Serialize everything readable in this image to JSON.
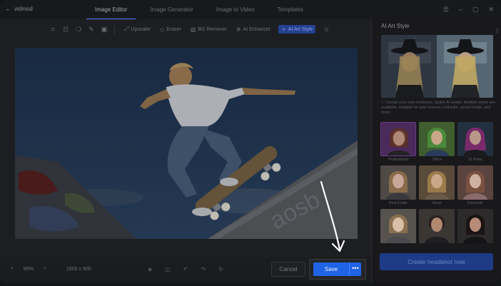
{
  "app": {
    "back_label": "vidmod"
  },
  "tabs": [
    {
      "label": "Image Editor",
      "active": true
    },
    {
      "label": "Image Generator",
      "active": false
    },
    {
      "label": "Image to Video",
      "active": false
    },
    {
      "label": "Templates",
      "active": false
    }
  ],
  "toolbar": {
    "features": [
      {
        "label": "Upscaler",
        "icon": "upscale-icon"
      },
      {
        "label": "Eraser",
        "icon": "eraser-icon"
      },
      {
        "label": "BG Remover",
        "icon": "bg-remove-icon"
      },
      {
        "label": "AI Enhancer",
        "icon": "sparkle-icon"
      },
      {
        "label": "AI Art Style",
        "icon": "art-style-icon",
        "active": true
      }
    ]
  },
  "bottombar": {
    "zoom_level": "85%",
    "dimensions": "1600 x 900",
    "cancel_label": "Cancel",
    "save_label": "Save",
    "more_label": "•••"
  },
  "panel": {
    "title": "AI Art Style",
    "description": "Create your own exclusive, stylish AI avatar. Multiple styles are available, suitable for your resume, LinkedIn, social media, and more.",
    "styles": [
      {
        "label": "Professional"
      },
      {
        "label": "Office"
      },
      {
        "label": "ID Photo"
      },
      {
        "label": "Real Estate"
      },
      {
        "label": "Street"
      },
      {
        "label": "Corporate"
      },
      {
        "label": ""
      },
      {
        "label": ""
      },
      {
        "label": ""
      }
    ],
    "cta_label": "Create headshot now"
  },
  "colors": {
    "accent": "#1f63e6",
    "cta": "#1d3b86",
    "background": "#1d1e21"
  }
}
